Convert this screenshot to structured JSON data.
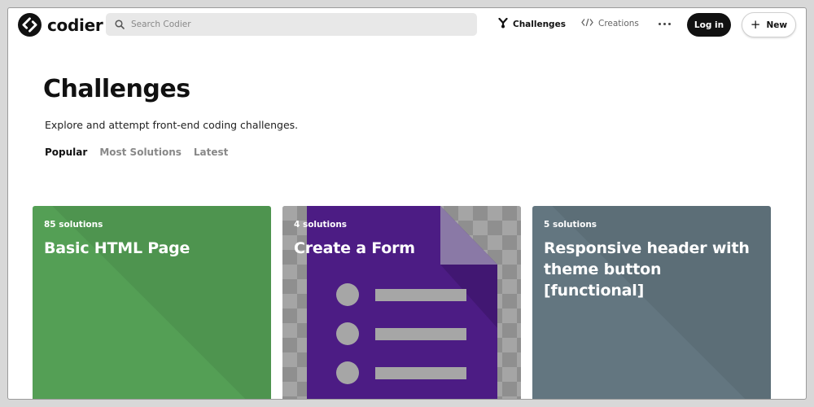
{
  "app": {
    "brand": "codier",
    "search_placeholder": "Search Codier"
  },
  "nav": {
    "challenges_label": "Challenges",
    "creations_label": "Creations",
    "login_label": "Log in",
    "new_label": "New"
  },
  "page": {
    "title": "Challenges",
    "subtitle": "Explore and attempt front-end coding challenges.",
    "tabs": [
      {
        "label": "Popular",
        "active": true
      },
      {
        "label": "Most Solutions",
        "active": false
      },
      {
        "label": "Latest",
        "active": false
      }
    ]
  },
  "cards": [
    {
      "solutions": "85 solutions",
      "title": "Basic HTML Page",
      "color": "#549f55"
    },
    {
      "solutions": "4 solutions",
      "title": "Create a Form",
      "color": "#4a1a80"
    },
    {
      "solutions": "5 solutions",
      "title": "Responsive header with theme button [functional]",
      "color": "#637680"
    }
  ],
  "colors": {
    "accent": "#111111",
    "search_bg": "#e8e8e8"
  }
}
